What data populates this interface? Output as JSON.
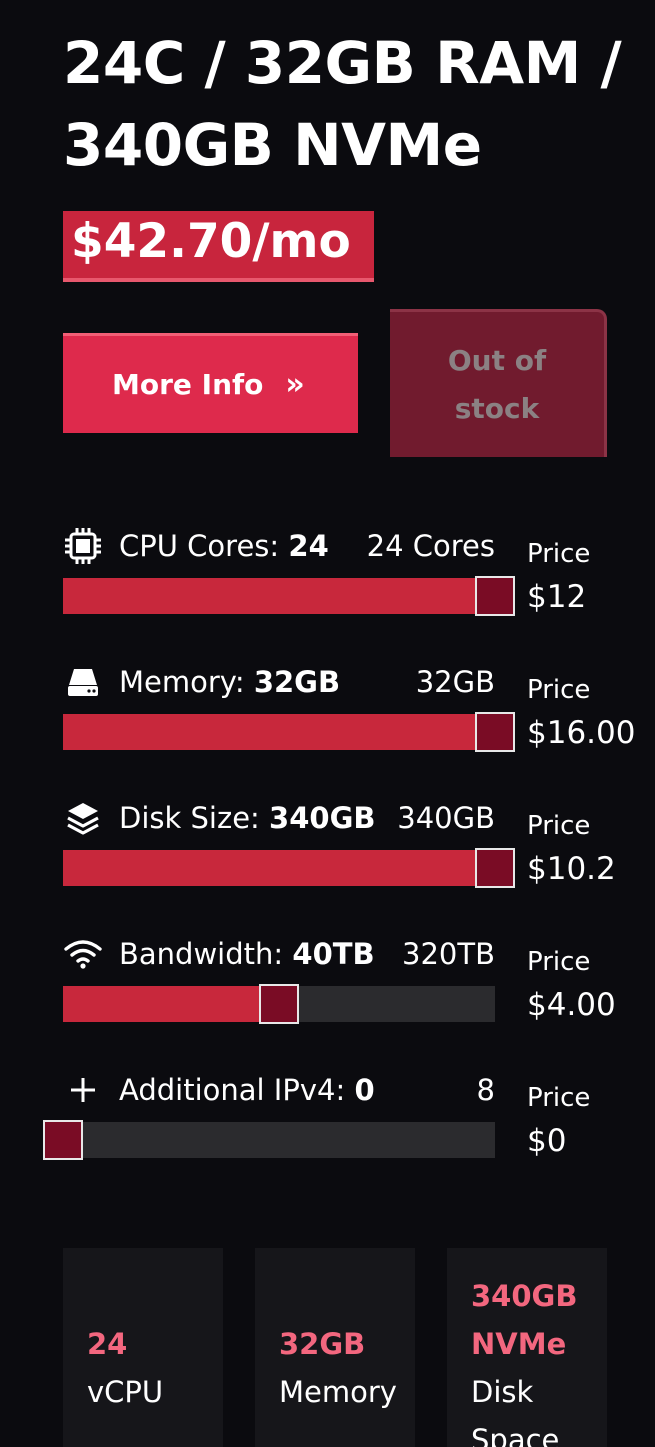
{
  "product": {
    "title": "24C / 32GB RAM / 340GB NVMe",
    "price": "$42.70/mo"
  },
  "buttons": {
    "more_info": "More Info",
    "more_info_chevron": "»",
    "out_of_stock": "Out of stock"
  },
  "sliders": [
    {
      "icon": "cpu-icon",
      "label": "CPU Cores:",
      "value": "24",
      "max_label": "24 Cores",
      "price_label": "Price",
      "price": "$12",
      "fraction": 1.0
    },
    {
      "icon": "memory-icon",
      "label": "Memory:",
      "value": "32GB",
      "max_label": "32GB",
      "price_label": "Price",
      "price": "$16.00",
      "fraction": 1.0
    },
    {
      "icon": "layers-icon",
      "label": "Disk Size:",
      "value": "340GB",
      "max_label": "340GB",
      "price_label": "Price",
      "price": "$10.2",
      "fraction": 1.0
    },
    {
      "icon": "wifi-icon",
      "label": "Bandwidth:",
      "value": "40TB",
      "max_label": "320TB",
      "price_label": "Price",
      "price": "$4.00",
      "fraction": 0.5
    },
    {
      "icon": "plus-icon",
      "label": "Additional IPv4:",
      "value": "0",
      "max_label": "8",
      "price_label": "Price",
      "price": "$0",
      "fraction": 0.0
    }
  ],
  "specs": [
    {
      "value": "24",
      "label": "vCPU"
    },
    {
      "value": "32GB",
      "label": "Memory"
    },
    {
      "value": "340GB NVMe",
      "label": "Disk Space"
    }
  ],
  "colors": {
    "accent": "#de2a4c",
    "slider_fill": "#c8283c",
    "thumb": "#7a0c25",
    "spec_value": "#f3677f",
    "background": "#0b0b0f"
  }
}
